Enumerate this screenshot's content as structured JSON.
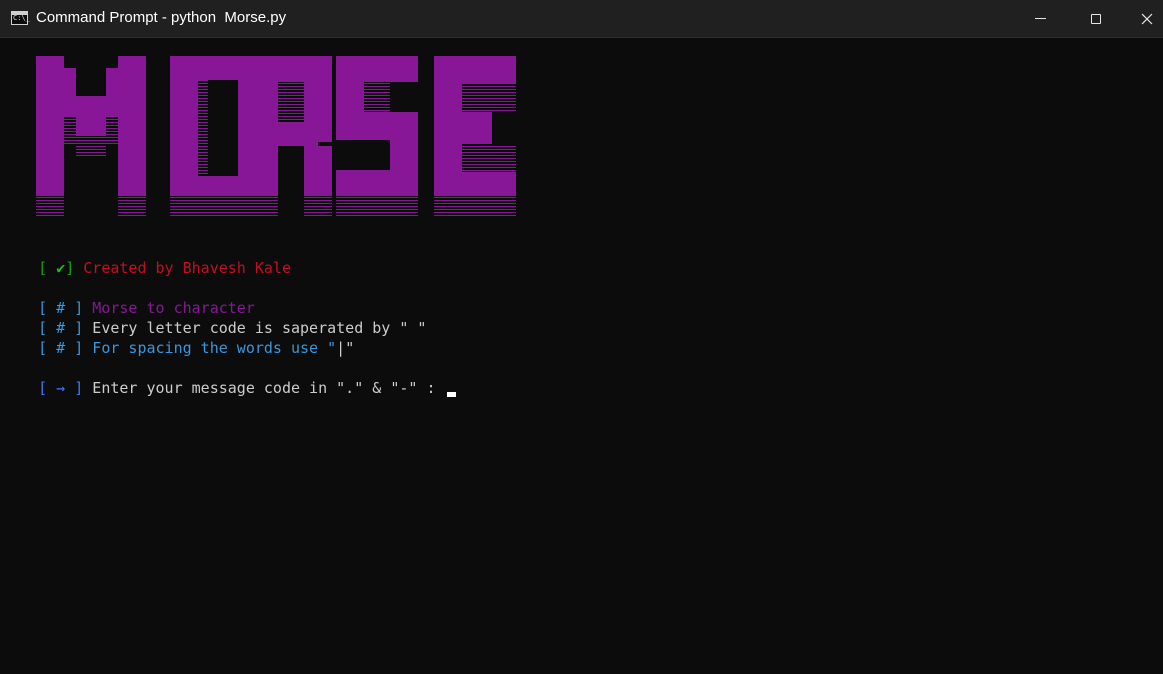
{
  "window": {
    "title": "Command Prompt - python  Morse.py",
    "icon": "cmd-icon",
    "icon_text": "C:\\_",
    "controls": [
      "minimize",
      "maximize",
      "close"
    ]
  },
  "banner": {
    "text": "MORSE",
    "color": "#881798"
  },
  "lines": {
    "credit": {
      "open": "[ ",
      "mark": "✔",
      "close": "]",
      "text": " Created by Bhavesh Kale"
    },
    "info1": {
      "prefix": "[ # ]",
      "text": " Morse to character"
    },
    "info2": {
      "prefix": "[ # ]",
      "text": " Every letter code is saperated by \" \""
    },
    "info3": {
      "prefix": "[ # ]",
      "text_a": " For spacing the words use \"",
      "pipe": "|",
      "text_b": "\""
    },
    "prompt": {
      "prefix": "[ → ]",
      "text": " Enter your message code in \".\" & \"-\" : "
    }
  },
  "colors": {
    "background": "#0c0c0c",
    "titlebar": "#202020",
    "bracket_green": "#13a10e",
    "check": "#16c60c",
    "credit": "#c50f1f",
    "purple": "#881798",
    "white": "#cccccc",
    "blue": "#3b78ff",
    "cyan": "#3a96dd"
  }
}
